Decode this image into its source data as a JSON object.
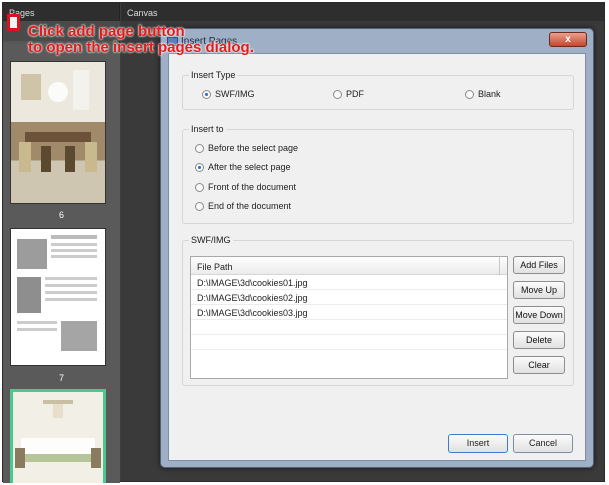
{
  "app": {
    "pages_panel_title": "Pages",
    "canvas_panel_title": "Canvas",
    "page_labels": [
      "6",
      "7"
    ]
  },
  "annotation": {
    "line1": "Click add page button",
    "line2": "to open the insert pages dialog."
  },
  "dialog": {
    "title": "Insert Pages",
    "close_label": "x",
    "insert_type": {
      "title": "Insert Type",
      "options": [
        {
          "label": "SWF/IMG",
          "checked": true
        },
        {
          "label": "PDF",
          "checked": false
        },
        {
          "label": "Blank",
          "checked": false
        }
      ]
    },
    "insert_to": {
      "title": "Insert to",
      "options": [
        {
          "label": "Before the select page",
          "checked": false
        },
        {
          "label": "After the select page",
          "checked": true
        },
        {
          "label": "Front of the document",
          "checked": false
        },
        {
          "label": "End of the document",
          "checked": false
        }
      ]
    },
    "swf_img": {
      "title": "SWF/IMG",
      "column_header": "File Path",
      "files": [
        "D:\\IMAGE\\3d\\cookies01.jpg",
        "D:\\IMAGE\\3d\\cookies02.jpg",
        "D:\\IMAGE\\3d\\cookies03.jpg"
      ],
      "buttons": {
        "add_files": "Add Files",
        "move_up": "Move Up",
        "move_down": "Move Down",
        "delete": "Delete",
        "clear": "Clear"
      }
    },
    "insert_label": "Insert",
    "cancel_label": "Cancel"
  },
  "colors": {
    "annotation": "#e31b1b",
    "selected_thumb": "#4cc78e",
    "radio_checked": "#2a6ad1"
  }
}
